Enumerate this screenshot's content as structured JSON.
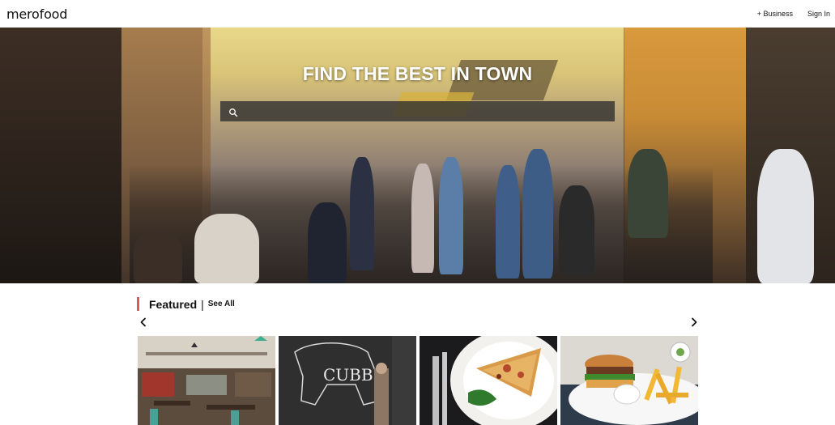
{
  "header": {
    "logo": "merofood",
    "nav": [
      {
        "label": "+ Business"
      },
      {
        "label": "Sign In"
      }
    ]
  },
  "hero": {
    "title": "FIND THE BEST IN TOWN",
    "search": {
      "placeholder": "",
      "value": ""
    }
  },
  "featured": {
    "title": "Featured",
    "separator": "|",
    "see_all": "See All",
    "cards": [
      {
        "image": "restaurant-interior"
      },
      {
        "image": "chalkboard-bull-mural"
      },
      {
        "image": "pizza-slice-plate"
      },
      {
        "image": "burger-and-fries"
      }
    ]
  },
  "colors": {
    "accent": "#e0565b",
    "search_bg": "#2d2d2d"
  }
}
